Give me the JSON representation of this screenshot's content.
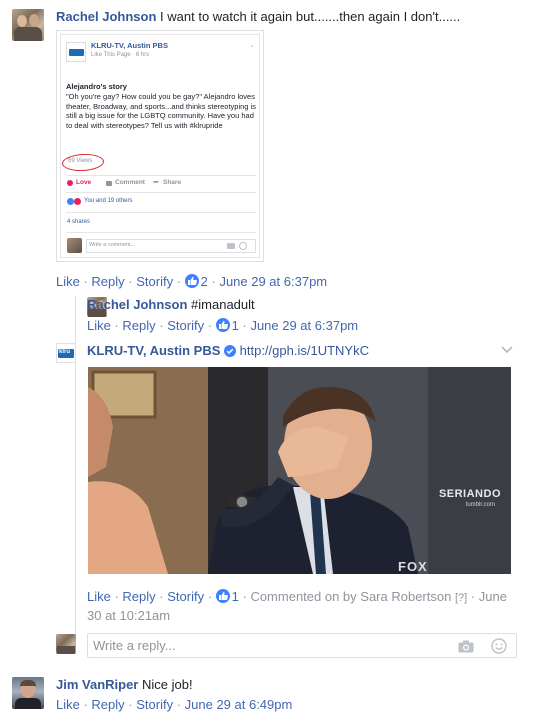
{
  "comment1": {
    "author": "Rachel Johnson",
    "text": "I want to watch it again but.......then again I don't......",
    "actions": {
      "like": "Like",
      "reply": "Reply",
      "storify": "Storify",
      "likes": "2",
      "time": "June 29 at 6:37pm"
    }
  },
  "embedded_post": {
    "page_name": "KLRU-TV, Austin PBS",
    "page_sub": "Like This Page · 6 hrs · ",
    "title": "Alejandro's story",
    "body": "\"Oh you're gay? How could you be gay?\" Alejandro loves theater, Broadway, and sports...and thinks stereotyping is still a big issue for the LGBTQ community. Have you had to deal with stereotypes? Tell us with #klrupride",
    "views": "69 Views",
    "like": "Love",
    "comment": "Comment",
    "share": "Share",
    "reactions": "You and 19 others",
    "shares": "4 shares",
    "write_comment_placeholder": "Write a comment...",
    "logo": "klru"
  },
  "reply1": {
    "author": "Rachel Johnson",
    "text": "#imanadult",
    "actions": {
      "like": "Like",
      "reply": "Reply",
      "storify": "Storify",
      "likes": "1",
      "time": "June 29 at 6:37pm"
    }
  },
  "reply2": {
    "author": "KLRU-TV, Austin PBS",
    "link": "http://gph.is/1UTNYkC",
    "logo": "klru",
    "gif_watermark": "SERIANDO",
    "gif_watermark_sub": "tumblr.com",
    "gif_network": "FOX",
    "actions": {
      "like": "Like",
      "reply": "Reply",
      "storify": "Storify",
      "likes": "1",
      "commented_by": "Commented on by Sara Robertson",
      "help": "[?]",
      "time": "June 30 at 10:21am"
    }
  },
  "reply_input": {
    "placeholder": "Write a reply..."
  },
  "comment2": {
    "author": "Jim VanRiper",
    "text": "Nice job!",
    "actions": {
      "like": "Like",
      "reply": "Reply",
      "storify": "Storify",
      "time": "June 29 at 6:49pm"
    }
  },
  "colors": {
    "fb_blue": "#365899",
    "link_blue": "#4267b2",
    "like_blue": "#4080ff",
    "verified": "#4080ff"
  }
}
